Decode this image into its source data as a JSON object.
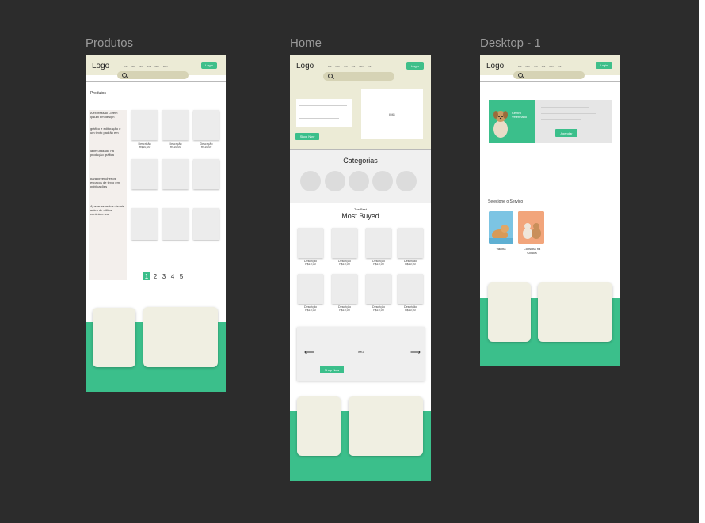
{
  "frames": {
    "produtos": {
      "title": "Produtos",
      "nav": {
        "logo": "Logo",
        "links": [
          "link",
          "item",
          "link",
          "link",
          "item",
          "item"
        ],
        "login": "Login"
      },
      "heading": "Produtos",
      "sidebar_paragraphs": [
        "A expressão Lorem Ipsum em design",
        "gráfico e editoração é um texto padrão em",
        "latim utilizado na produção gráfica",
        "para preencher os espaços de texto em publicações",
        "Ajustar aspectos visuais antes de utilizar conteúdo real"
      ],
      "products": [
        {
          "desc": "Descrição",
          "price": "R$10,00"
        },
        {
          "desc": "Descrição",
          "price": "R$10,00"
        },
        {
          "desc": "Descrição",
          "price": "R$10,00"
        }
      ],
      "pagination": [
        "1",
        "2",
        "3",
        "4",
        "5"
      ]
    },
    "home": {
      "title": "Home",
      "nav": {
        "logo": "Logo",
        "links": [
          "link",
          "item",
          "link",
          "link",
          "item",
          "link"
        ],
        "login": "Login"
      },
      "hero": {
        "img": "IMG",
        "button": "Shop Now"
      },
      "categories_title": "Categorias",
      "best": {
        "kicker": "The Best",
        "title": "Most Buyed"
      },
      "products": [
        {
          "desc": "Descrição",
          "price": "R$10,00"
        },
        {
          "desc": "Descrição",
          "price": "R$10,00"
        },
        {
          "desc": "Descrição",
          "price": "R$10,00"
        },
        {
          "desc": "Descrição",
          "price": "R$10,00"
        },
        {
          "desc": "Descrição",
          "price": "R$10,00"
        },
        {
          "desc": "Descrição",
          "price": "R$10,00"
        },
        {
          "desc": "Descrição",
          "price": "R$10,00"
        },
        {
          "desc": "Descrição",
          "price": "R$10,00"
        }
      ],
      "carousel": {
        "img": "IMG",
        "button": "Shop Now",
        "prev": "⟵",
        "next": "⟶"
      }
    },
    "desktop": {
      "title": "Desktop - 1",
      "nav": {
        "logo": "Logo",
        "links": [
          "link",
          "item",
          "link",
          "link",
          "item",
          "link"
        ],
        "login": "Login"
      },
      "hero_text": "Centro Veterinário",
      "hero_button": "Agendar",
      "service_heading": "Selecione o Serviço",
      "services": [
        {
          "label": "Vacina"
        },
        {
          "label": "Consulta na Clínica"
        }
      ]
    }
  },
  "colors": {
    "canvas": "#2c2c2c",
    "accent": "#3bbf8b",
    "cream": "#f0efe2",
    "nav": "#ecebd6"
  }
}
